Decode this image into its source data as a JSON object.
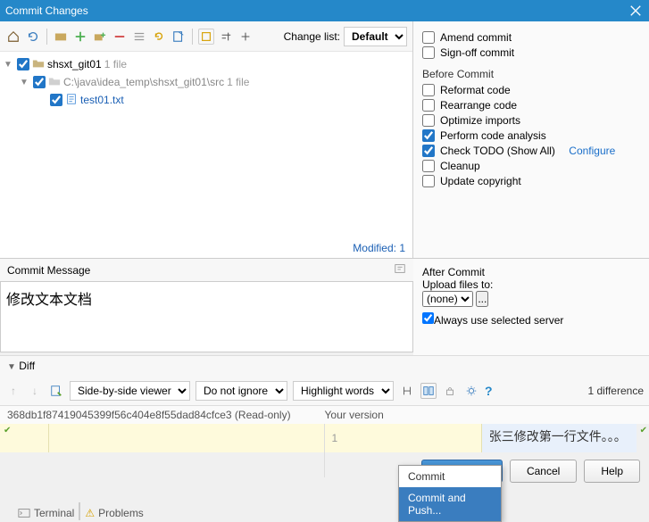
{
  "titlebar": {
    "title": "Commit Changes"
  },
  "toolbar": {
    "changelist_label": "Change list:",
    "changelist_value": "Default"
  },
  "tree": {
    "root": {
      "name": "shsxt_git01",
      "count": "1 file"
    },
    "child": {
      "name": "C:\\java\\idea_temp\\shsxt_git01\\src",
      "count": "1 file"
    },
    "file": {
      "name": "test01.txt"
    }
  },
  "modified": "Modified: 1",
  "right": {
    "amend": "Amend commit",
    "signoff": "Sign-off commit",
    "before_label": "Before Commit",
    "reformat": "Reformat code",
    "rearrange": "Rearrange code",
    "optimize": "Optimize imports",
    "analysis": "Perform code analysis",
    "todo": "Check TODO (Show All)",
    "configure": "Configure",
    "cleanup": "Cleanup",
    "copyright": "Update copyright",
    "after_label": "After Commit",
    "upload_label": "Upload files to:",
    "upload_value": "(none)",
    "always_server": "Always use selected server"
  },
  "commit_msg": {
    "header": "Commit Message",
    "value": "修改文本文档"
  },
  "diff": {
    "header": "Diff",
    "viewer": "Side-by-side viewer",
    "ignore": "Do not ignore",
    "highlight": "Highlight words",
    "count": "1 difference",
    "left_header_hash": "368db1f87419045399f56c404e8f55dad84cfce3 (Read-only)",
    "right_header": "Your version",
    "line_num": "1",
    "right_text": "张三修改第一行文件。。。"
  },
  "buttons": {
    "commit": "Commit",
    "cancel": "Cancel",
    "help": "Help"
  },
  "dropdown": {
    "commit": "Commit",
    "commit_push": "Commit and Push..."
  },
  "bottom": {
    "terminal": "Terminal",
    "problems": "Problems"
  }
}
